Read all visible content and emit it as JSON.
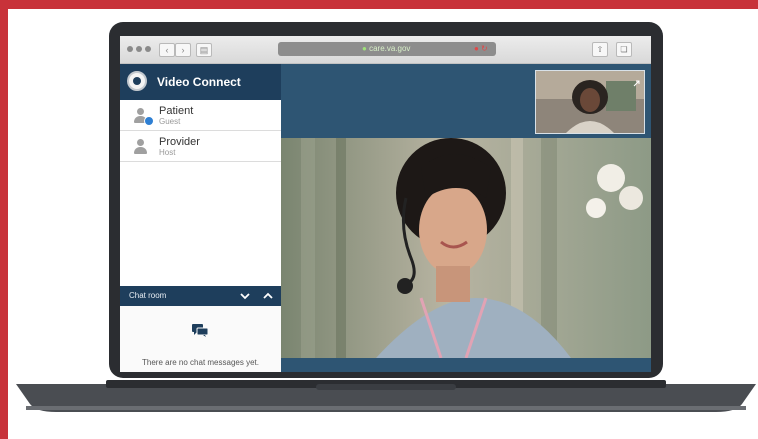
{
  "browser": {
    "url": "care.va.gov",
    "lock_icon": "lock-icon",
    "nav_icons": [
      "back-icon",
      "forward-icon",
      "sidebar-icon"
    ],
    "toolbar_icons": [
      "share-icon",
      "tabs-icon"
    ]
  },
  "app": {
    "title": "Video Connect",
    "logo_icon": "va-seal-icon",
    "brand_color": "#1e3e5c"
  },
  "participants": [
    {
      "name": "Patient",
      "role": "Guest",
      "icon": "person-icon",
      "has_badge": true
    },
    {
      "name": "Provider",
      "role": "Host",
      "icon": "person-icon",
      "has_badge": false
    }
  ],
  "chat": {
    "title": "Chat room",
    "collapse_icon": "chevron-down-icon",
    "expand_icon": "chevron-up-icon",
    "empty_icon": "chat-bubble-icon",
    "empty_message": "There are no chat messages yet."
  },
  "video": {
    "self_view_icon": "expand-icon",
    "frame_color": "#c8323a"
  }
}
